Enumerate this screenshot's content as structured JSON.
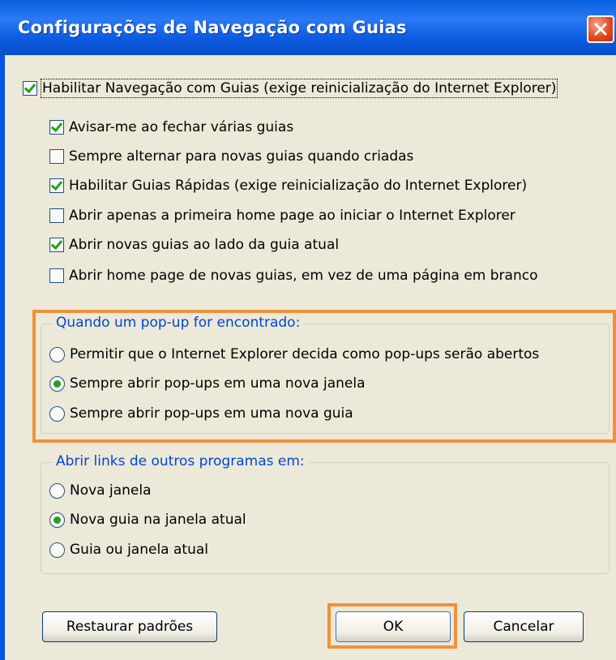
{
  "title": "Configurações de Navegação com Guias",
  "enable_tabs": {
    "label": "Habilitar Navegação com Guias (exige reinicialização do Internet Explorer)",
    "checked": true
  },
  "options": [
    {
      "label": "Avisar-me ao fechar várias guias",
      "checked": true
    },
    {
      "label": "Sempre alternar para novas guias quando criadas",
      "checked": false
    },
    {
      "label": "Habilitar Guias Rápidas (exige reinicialização do Internet Explorer)",
      "checked": true
    },
    {
      "label": "Abrir apenas a primeira home page ao iniciar o Internet Explorer",
      "checked": false
    },
    {
      "label": "Abrir novas guias ao lado da guia atual",
      "checked": true
    },
    {
      "label": "Abrir home page de novas guias, em vez de uma página em branco",
      "checked": false
    }
  ],
  "popup_group": {
    "legend": "Quando um pop-up for encontrado:",
    "options": [
      {
        "label": "Permitir que o Internet Explorer decida como pop-ups serão abertos",
        "selected": false
      },
      {
        "label": "Sempre abrir pop-ups em uma nova janela",
        "selected": true
      },
      {
        "label": "Sempre abrir pop-ups em uma nova guia",
        "selected": false
      }
    ]
  },
  "links_group": {
    "legend": "Abrir links de outros programas em:",
    "options": [
      {
        "label": "Nova janela",
        "selected": false
      },
      {
        "label": "Nova guia na janela atual",
        "selected": true
      },
      {
        "label": "Guia ou janela atual",
        "selected": false
      }
    ]
  },
  "buttons": {
    "restore": "Restaurar padrões",
    "ok": "OK",
    "cancel": "Cancelar"
  },
  "colors": {
    "highlight": "#f0913a",
    "legend": "#0046d5",
    "titlebar": "#0a5fe0"
  }
}
